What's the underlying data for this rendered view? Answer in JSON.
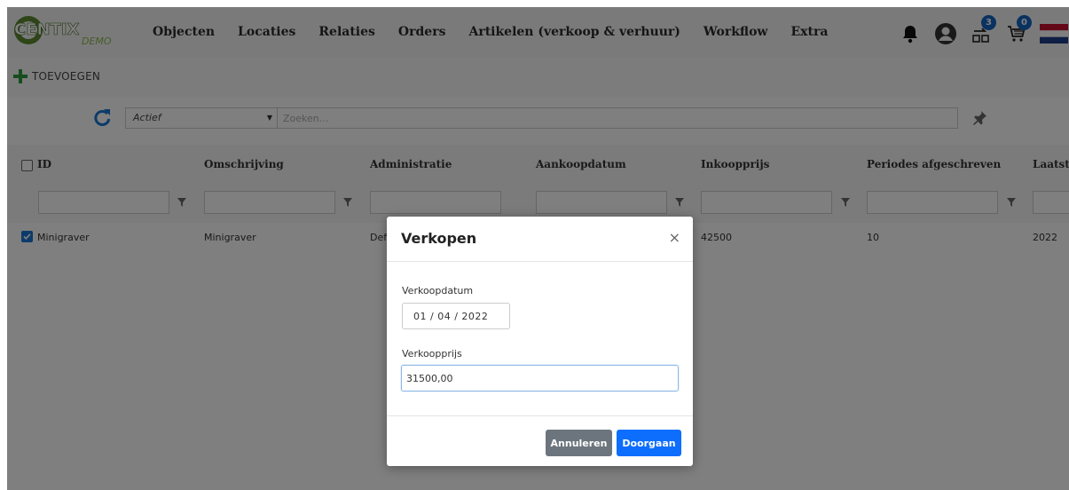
{
  "logo": {
    "text": "CENTIX",
    "sub": "DEMO"
  },
  "nav": {
    "items": [
      {
        "label": "Objecten"
      },
      {
        "label": "Locaties"
      },
      {
        "label": "Relaties"
      },
      {
        "label": "Orders"
      },
      {
        "label": "Artikelen (verkoop & verhuur)"
      },
      {
        "label": "Workflow"
      },
      {
        "label": "Extra"
      }
    ]
  },
  "header_icons": {
    "notifications": "bell-icon",
    "account": "user-icon",
    "transfer_badge": "3",
    "cart_badge": "0",
    "language": "Nederlands"
  },
  "toolbar": {
    "add_label": "TOEVOEGEN"
  },
  "filter": {
    "status_value": "Actief",
    "search_placeholder": "Zoeken..."
  },
  "grid": {
    "columns": [
      "ID",
      "Omschrijving",
      "Administratie",
      "Aankoopdatum",
      "Inkoopprijs",
      "Periodes afgeschreven",
      "Laatst"
    ],
    "rows": [
      {
        "id": "Minigraver",
        "omschrijving": "Minigraver",
        "administratie": "Def",
        "inkoopprijs": "42500",
        "periodes": "10",
        "laatst": "2022"
      }
    ]
  },
  "modal": {
    "title": "Verkopen",
    "close": "×",
    "date_label": "Verkoopdatum",
    "date_value": "01  /  04  /  2022",
    "price_label": "Verkoopprijs",
    "price_value": "31500,00",
    "cancel_label": "Annuleren",
    "ok_label": "Doorgaan"
  },
  "colors": {
    "primary": "#0d6efd",
    "secondary": "#6c757d",
    "accent_green": "#2e9b3e",
    "refresh_blue": "#1976d2"
  }
}
